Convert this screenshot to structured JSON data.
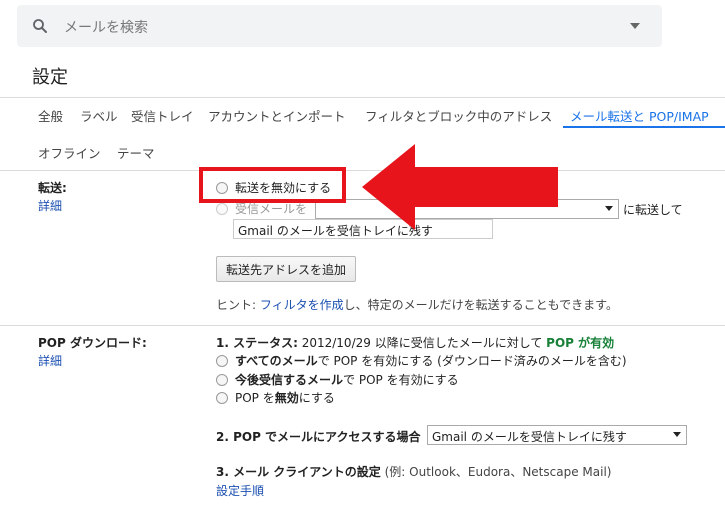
{
  "search": {
    "placeholder": "メールを検索",
    "icon": "search-icon",
    "dropdown_icon": "caret-down-icon"
  },
  "page_title": "設定",
  "tabs": [
    {
      "label": "全般"
    },
    {
      "label": "ラベル"
    },
    {
      "label": "受信トレイ"
    },
    {
      "label": "アカウントとインポート"
    },
    {
      "label": "フィルタとブロック中のアドレス"
    },
    {
      "label": "メール転送と POP/IMAP",
      "active": true
    },
    {
      "label": "オフライン"
    },
    {
      "label": "テーマ"
    }
  ],
  "forwarding": {
    "label": "転送:",
    "detail_link": "詳細",
    "option_disable": "転送を無効にする",
    "option_forward_prefix": "受信メールを",
    "option_forward_suffix": "に転送して",
    "keep_select_value": "Gmail のメールを受信トレイに残す",
    "add_button": "転送先アドレスを追加",
    "hint_prefix": "ヒント: ",
    "hint_link": "フィルタを作成",
    "hint_suffix": "し、特定のメールだけを転送することもできます。"
  },
  "pop": {
    "label": "POP ダウンロード:",
    "detail_link": "詳細",
    "status_heading": "1. ステータス:",
    "status_text": "2012/10/29 以降に受信したメールに対して",
    "status_enabled": "POP が有効",
    "options": [
      {
        "bold": "すべてのメール",
        "rest": "で POP を有効にする (ダウンロード済みのメールを含む)"
      },
      {
        "bold": "今後受信するメール",
        "rest": "で POP を有効にする"
      },
      {
        "bold": "",
        "rest": "POP を",
        "bold2": "無効",
        "rest2": "にする"
      }
    ],
    "access_heading": "2. POP でメールにアクセスする場合",
    "access_select_value": "Gmail のメールを受信トレイに残す",
    "client_heading": "3. メール クライアントの設定",
    "client_examples": "(例: Outlook、Eudora、Netscape Mail)",
    "setup_link": "設定手順"
  },
  "colors": {
    "accent": "#1a73e8",
    "link": "#1a4fb0",
    "annotation_red": "#e8141c",
    "enabled_green": "#188038"
  }
}
